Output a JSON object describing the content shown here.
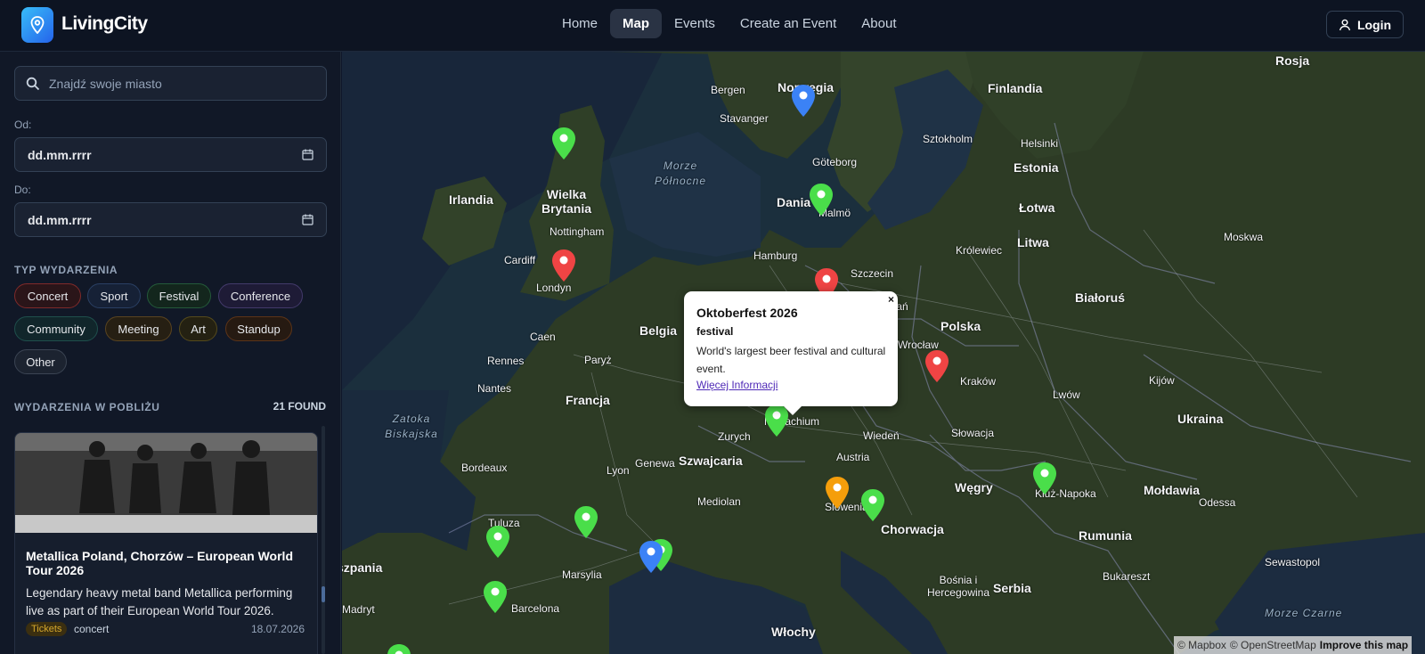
{
  "app": {
    "brand": "LivingCity"
  },
  "nav": {
    "items": [
      {
        "label": "Home"
      },
      {
        "label": "Map",
        "active": true
      },
      {
        "label": "Events"
      },
      {
        "label": "Create an Event"
      },
      {
        "label": "About"
      }
    ],
    "login_label": "Login"
  },
  "sidebar": {
    "search_placeholder": "Znajdź swoje miasto",
    "from_label": "Od:",
    "from_value": "dd.mm.rrrr",
    "to_label": "Do:",
    "to_value": "dd.mm.rrrr",
    "event_type_heading": "TYP WYDARZENIA",
    "event_types": [
      {
        "label": "Concert",
        "color": "#ef4444"
      },
      {
        "label": "Sport",
        "color": "#3b82f6"
      },
      {
        "label": "Festival",
        "color": "#22c55e"
      },
      {
        "label": "Conference",
        "color": "#8b5cf6"
      },
      {
        "label": "Community",
        "color": "#14b8a6"
      },
      {
        "label": "Meeting",
        "color": "#f59e0b"
      },
      {
        "label": "Art",
        "color": "#eab308"
      },
      {
        "label": "Standup",
        "color": "#f97316"
      },
      {
        "label": "Other",
        "color": "#64748b"
      }
    ],
    "nearby_heading": "WYDARZENIA W POBLIŻU",
    "found_count": "21 FOUND",
    "events": [
      {
        "title": "Metallica Poland, Chorzów – European World Tour 2026",
        "description": "Legendary heavy metal band Metallica performing live as part of their European World Tour 2026.",
        "tag": "Tickets",
        "type": "concert",
        "date": "18.07.2026"
      }
    ]
  },
  "map": {
    "labels": {
      "norwegia": "Norwegia",
      "finlandia": "Finlandia",
      "rosja": "Rosja",
      "estonia": "Estonia",
      "lotwa": "Łotwa",
      "litwa": "Litwa",
      "bialorus": "Białoruś",
      "polska": "Polska",
      "ukraina": "Ukraina",
      "moldawia": "Mołdawia",
      "rumunia": "Rumunia",
      "wegry": "Węgry",
      "slowacja": "Słowacja",
      "austria": "Austria",
      "chorwacja": "Chorwacja",
      "serbia": "Serbia",
      "bosnia": "Bośnia i Hercegowina",
      "wlochy": "Włochy",
      "szwajcaria": "Szwajcaria",
      "francja": "Francja",
      "hiszpania": "szpania",
      "dania": "Dania",
      "wielka_brytania": "Wielka Brytania",
      "irlandia": "Irlandia",
      "belgia": "Belgia",
      "morze_polnocne": "Morze Północne",
      "zatoka_biskajska": "Zatoka Biskajska",
      "morze_czarne": "Morze Czarne",
      "moskwa": "Moskwa",
      "sztokholm": "Sztokholm",
      "helsinki": "Helsinki",
      "londyn": "Londyn",
      "paryz": "Paryż",
      "madryt": "Madryt",
      "barcelona": "Barcelona",
      "marsylia": "Marsylia",
      "krakow": "Kraków",
      "monachium": "Monachium",
      "wieden": "Wiedeń",
      "bukareszt": "Bukareszt",
      "odessa": "Odessa",
      "kijow": "Kijów",
      "hamburg": "Hamburg",
      "slowenia": "Slowenia",
      "kluz": "Kluż-Napoka",
      "tuluza": "Tuluza",
      "mediolan": "Mediolan",
      "zurych": "Zurych",
      "genewa": "Genewa",
      "lyon": "Lyon",
      "bordeaux": "Bordeaux",
      "nantes": "Nantes",
      "rennes": "Rennes",
      "caen": "Caen",
      "cardiff": "Cardiff",
      "nottingham": "Nottingham",
      "goteborg": "Göteborg",
      "malmo": "Malmö",
      "bergen": "Bergen",
      "stavanger": "Stavanger",
      "krolewiec": "Królewiec",
      "szczecin": "Szczecin",
      "poznan": "Poznań",
      "wroclaw": "Wrocław",
      "lwow": "Lwów",
      "sewastopol": "Sewastopol"
    },
    "popup": {
      "title": "Oktoberfest 2026",
      "type": "festival",
      "description": "World's largest beer festival and cultural event.",
      "link": "Więcej Informacji",
      "close": "×"
    },
    "attribution": {
      "mapbox": "© Mapbox",
      "osm": "© OpenStreetMap",
      "improve": "Improve this map"
    }
  }
}
